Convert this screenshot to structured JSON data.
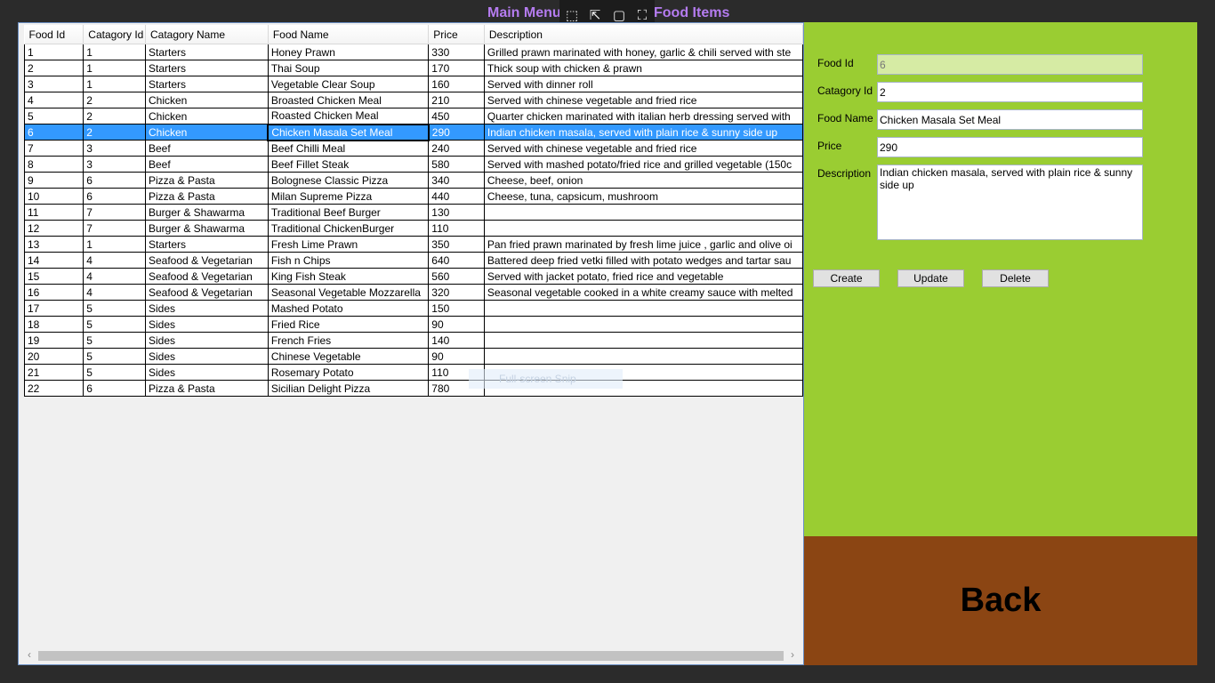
{
  "nav": {
    "main_menu": "Main Menu",
    "page_title": "Food Items"
  },
  "snip": {
    "label": "Full-screen Snip"
  },
  "grid": {
    "columns": [
      "Food Id",
      "Catagory Id",
      "Catagory Name",
      "Food Name",
      "Price",
      "Description"
    ],
    "rows": [
      [
        "1",
        "1",
        "Starters",
        "Honey Prawn",
        "330",
        "Grilled prawn marinated with honey, garlic & chili served with ste"
      ],
      [
        "2",
        "1",
        "Starters",
        "Thai Soup",
        "170",
        "Thick soup with chicken & prawn"
      ],
      [
        "3",
        "1",
        "Starters",
        "Vegetable Clear Soup",
        "160",
        "Served with dinner roll"
      ],
      [
        "4",
        "2",
        "Chicken",
        "Broasted Chicken Meal",
        "210",
        "Served with chinese vegetable and fried rice"
      ],
      [
        "5",
        "2",
        "Chicken",
        "Roasted Chicken Meal",
        "450",
        "Quarter chicken marinated with italian herb dressing served with"
      ],
      [
        "6",
        "2",
        "Chicken",
        "Chicken Masala Set Meal",
        "290",
        "Indian chicken masala, served with plain rice & sunny side up"
      ],
      [
        "7",
        "3",
        "Beef",
        "Beef Chilli Meal",
        "240",
        "Served with chinese vegetable and fried rice"
      ],
      [
        "8",
        "3",
        "Beef",
        "Beef Fillet Steak",
        "580",
        "Served with mashed potato/fried rice and grilled vegetable (150c"
      ],
      [
        "9",
        "6",
        "Pizza & Pasta",
        "Bolognese Classic Pizza",
        "340",
        "Cheese, beef, onion"
      ],
      [
        "10",
        "6",
        "Pizza & Pasta",
        "Milan Supreme Pizza",
        "440",
        "Cheese, tuna, capsicum, mushroom"
      ],
      [
        "11",
        "7",
        "Burger & Shawarma",
        "Traditional Beef Burger",
        "130",
        ""
      ],
      [
        "12",
        "7",
        "Burger & Shawarma",
        "Traditional ChickenBurger",
        "110",
        ""
      ],
      [
        "13",
        "1",
        "Starters",
        "Fresh Lime Prawn",
        "350",
        "Pan fried prawn marinated by fresh lime juice , garlic and olive oi"
      ],
      [
        "14",
        "4",
        "Seafood & Vegetarian",
        "Fish n Chips",
        "640",
        "Battered deep fried vetki filled with potato wedges and tartar sau"
      ],
      [
        "15",
        "4",
        "Seafood & Vegetarian",
        "King Fish Steak",
        "560",
        "Served with jacket potato, fried rice and vegetable"
      ],
      [
        "16",
        "4",
        "Seafood & Vegetarian",
        "Seasonal Vegetable Mozzarella",
        "320",
        "Seasonal vegetable cooked in a white creamy sauce with melted"
      ],
      [
        "17",
        "5",
        "Sides",
        "Mashed Potato",
        "150",
        ""
      ],
      [
        "18",
        "5",
        "Sides",
        "Fried Rice",
        "90",
        ""
      ],
      [
        "19",
        "5",
        "Sides",
        "French Fries",
        "140",
        ""
      ],
      [
        "20",
        "5",
        "Sides",
        "Chinese Vegetable",
        "90",
        ""
      ],
      [
        "21",
        "5",
        "Sides",
        "Rosemary Potato",
        "110",
        ""
      ],
      [
        "22",
        "6",
        "Pizza & Pasta",
        "Sicilian Delight Pizza",
        "780",
        ""
      ]
    ],
    "selected_row_index": 5
  },
  "form": {
    "food_id_label": "Food Id",
    "food_id_value": "6",
    "category_id_label": "Catagory Id",
    "category_id_value": "2",
    "food_name_label": "Food Name",
    "food_name_value": "Chicken Masala Set Meal",
    "price_label": "Price",
    "price_value": "290",
    "description_label": "Description",
    "description_value": "Indian chicken masala, served with plain rice & sunny side up",
    "create_label": "Create",
    "update_label": "Update",
    "delete_label": "Delete"
  },
  "back": {
    "label": "Back"
  },
  "colors": {
    "panel": "#9acd32",
    "back": "#8b4513",
    "selection": "#3399ff",
    "title": "#b57cf0"
  }
}
